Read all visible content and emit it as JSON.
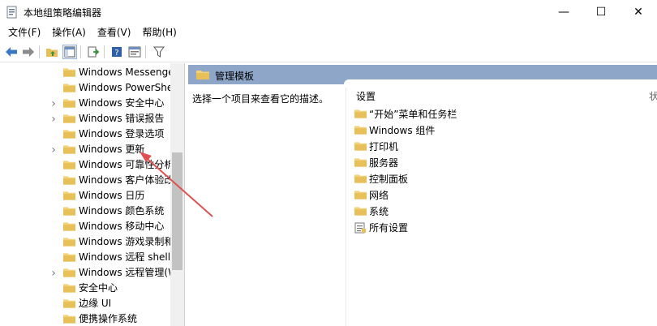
{
  "window": {
    "title": "本地组策略编辑器",
    "min_glyph": "—",
    "max_glyph": "☐",
    "close_glyph": "✕"
  },
  "menu": [
    "文件(F)",
    "操作(A)",
    "查看(V)",
    "帮助(H)"
  ],
  "tree": {
    "items": [
      {
        "label": "Windows Messenge",
        "expandable": false
      },
      {
        "label": "Windows PowerShel",
        "expandable": false
      },
      {
        "label": "Windows 安全中心",
        "expandable": true
      },
      {
        "label": "Windows 错误报告",
        "expandable": true
      },
      {
        "label": "Windows 登录选项",
        "expandable": false
      },
      {
        "label": "Windows 更新",
        "expandable": true
      },
      {
        "label": "Windows 可靠性分析",
        "expandable": false
      },
      {
        "label": "Windows 客户体验改",
        "expandable": false
      },
      {
        "label": "Windows 日历",
        "expandable": false
      },
      {
        "label": "Windows 颜色系统",
        "expandable": false
      },
      {
        "label": "Windows 移动中心",
        "expandable": false
      },
      {
        "label": "Windows 游戏录制和",
        "expandable": false
      },
      {
        "label": "Windows 远程 shell",
        "expandable": false
      },
      {
        "label": "Windows 远程管理(W",
        "expandable": true
      },
      {
        "label": "安全中心",
        "expandable": false
      },
      {
        "label": "边缘 UI",
        "expandable": false
      },
      {
        "label": "便携操作系统",
        "expandable": false
      }
    ]
  },
  "content": {
    "header_title": "管理模板",
    "description": "选择一个项目来查看它的描述。",
    "column_settings": "设置",
    "column_state_partial": "状",
    "items": [
      {
        "label": "“开始”菜单和任务栏",
        "icon": "folder-icon"
      },
      {
        "label": "Windows 组件",
        "icon": "folder-icon"
      },
      {
        "label": "打印机",
        "icon": "folder-icon"
      },
      {
        "label": "服务器",
        "icon": "folder-icon"
      },
      {
        "label": "控制面板",
        "icon": "folder-icon"
      },
      {
        "label": "网络",
        "icon": "folder-icon"
      },
      {
        "label": "系统",
        "icon": "folder-icon"
      },
      {
        "label": "所有设置",
        "icon": "settings-list-icon"
      }
    ]
  },
  "colors": {
    "header_band": "#8ea7c9",
    "folder": "#e8c05a",
    "annotation_arrow": "#e05050"
  }
}
